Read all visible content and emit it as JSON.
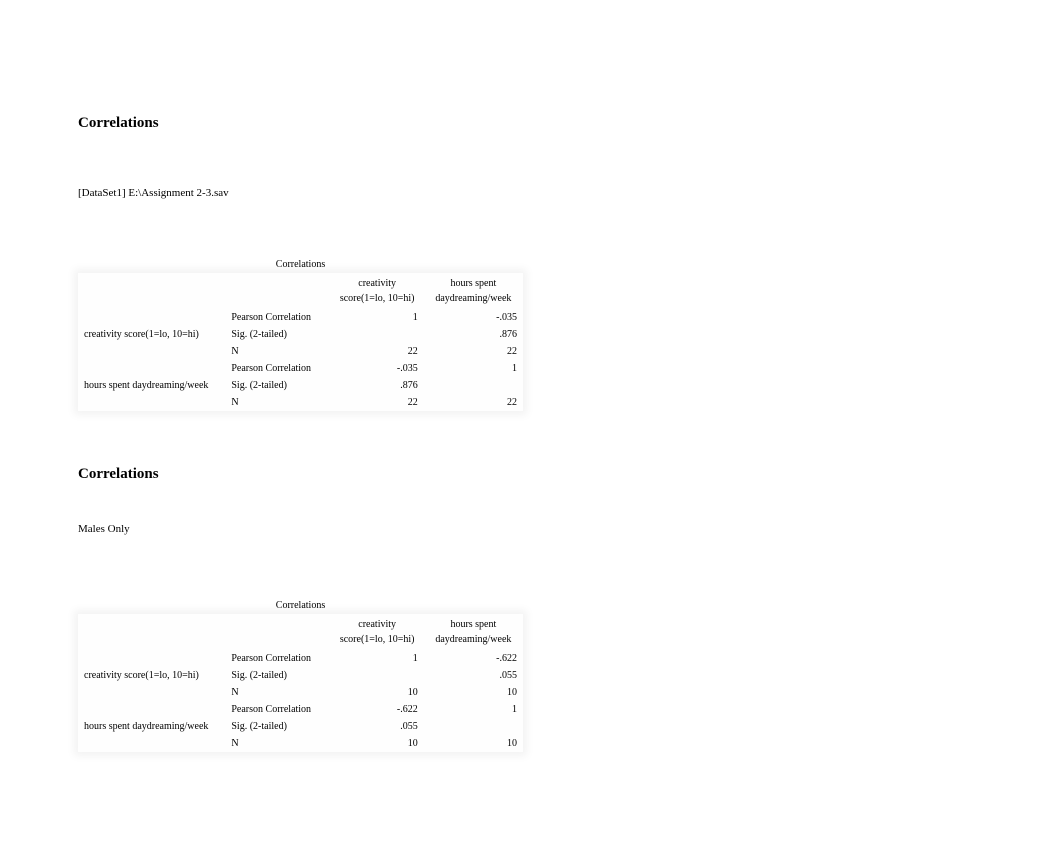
{
  "section1": {
    "heading": "Correlations",
    "dataset_line": "[DataSet1] E:\\Assignment 2-3.sav",
    "table": {
      "title": "Correlations",
      "col1": "creativity score(1=lo, 10=hi)",
      "col2": "hours spent daydreaming/week",
      "rows": [
        {
          "var": "creativity score(1=lo, 10=hi)",
          "pearson_label": "Pearson Correlation",
          "pearson_v1": "1",
          "pearson_v2": "-.035",
          "sig_label": "Sig. (2-tailed)",
          "sig_v1": "",
          "sig_v2": ".876",
          "n_label": "N",
          "n_v1": "22",
          "n_v2": "22"
        },
        {
          "var": "hours spent daydreaming/week",
          "pearson_label": "Pearson Correlation",
          "pearson_v1": "-.035",
          "pearson_v2": "1",
          "sig_label": "Sig. (2-tailed)",
          "sig_v1": ".876",
          "sig_v2": "",
          "n_label": "N",
          "n_v1": "22",
          "n_v2": "22"
        }
      ]
    }
  },
  "section2": {
    "heading": "Correlations",
    "subtitle": "Males Only",
    "table": {
      "title": "Correlations",
      "col1": "creativity score(1=lo, 10=hi)",
      "col2": "hours spent daydreaming/week",
      "rows": [
        {
          "var": "creativity score(1=lo, 10=hi)",
          "pearson_label": "Pearson Correlation",
          "pearson_v1": "1",
          "pearson_v2": "-.622",
          "sig_label": "Sig. (2-tailed)",
          "sig_v1": "",
          "sig_v2": ".055",
          "n_label": "N",
          "n_v1": "10",
          "n_v2": "10"
        },
        {
          "var": "hours spent daydreaming/week",
          "pearson_label": "Pearson Correlation",
          "pearson_v1": "-.622",
          "pearson_v2": "1",
          "sig_label": "Sig. (2-tailed)",
          "sig_v1": ".055",
          "sig_v2": "",
          "n_label": "N",
          "n_v1": "10",
          "n_v2": "10"
        }
      ]
    }
  }
}
